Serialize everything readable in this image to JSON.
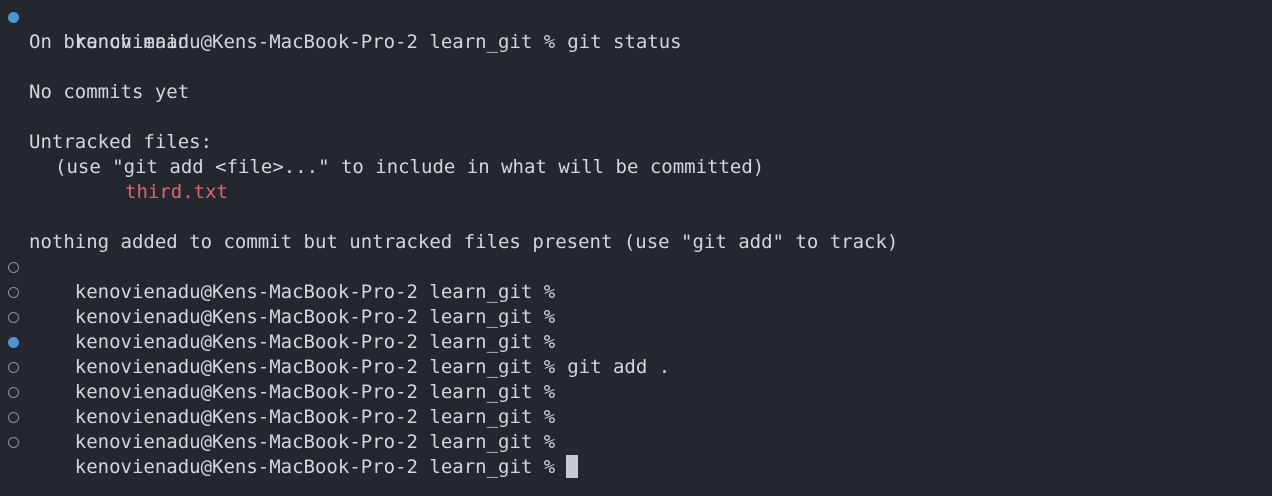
{
  "prompt": "kenovienadu@Kens-MacBook-Pro-2 learn_git %",
  "commands": {
    "git_status": "git status",
    "git_add": "git add ."
  },
  "output": {
    "branch": "On branch main",
    "no_commits": "No commits yet",
    "untracked_header": "Untracked files:",
    "untracked_hint": "(use \"git add <file>...\" to include in what will be committed)",
    "untracked_file": "third.txt",
    "summary": "nothing added to commit but untracked files present (use \"git add\" to track)"
  },
  "colors": {
    "background": "#25272e",
    "text": "#d4d6da",
    "untracked_file": "#e0646b",
    "success_marker": "#4a97cf",
    "empty_marker": "#8d9096"
  }
}
